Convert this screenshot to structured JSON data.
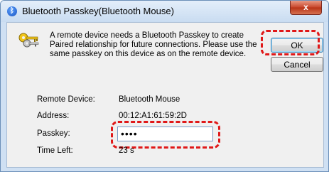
{
  "window": {
    "title": "Bluetooth Passkey(Bluetooth Mouse)",
    "close_label": "x"
  },
  "dialog": {
    "message": "A remote device needs a Bluetooth Passkey to create Paired relationship for future connections. Please use the same passkey on this device as on the remote device.",
    "ok_label": "OK",
    "cancel_label": "Cancel"
  },
  "fields": {
    "remote_device_label": "Remote Device:",
    "remote_device_value": "Bluetooth Mouse",
    "address_label": "Address:",
    "address_value": "00:12:A1:61:59:2D",
    "passkey_label": "Passkey:",
    "passkey_value": "••••",
    "time_left_label": "Time Left:",
    "time_left_value": "23 s"
  },
  "icons": {
    "title": "bluetooth-icon",
    "dialog": "keys-icon"
  },
  "colors": {
    "highlight": "#e01818"
  }
}
